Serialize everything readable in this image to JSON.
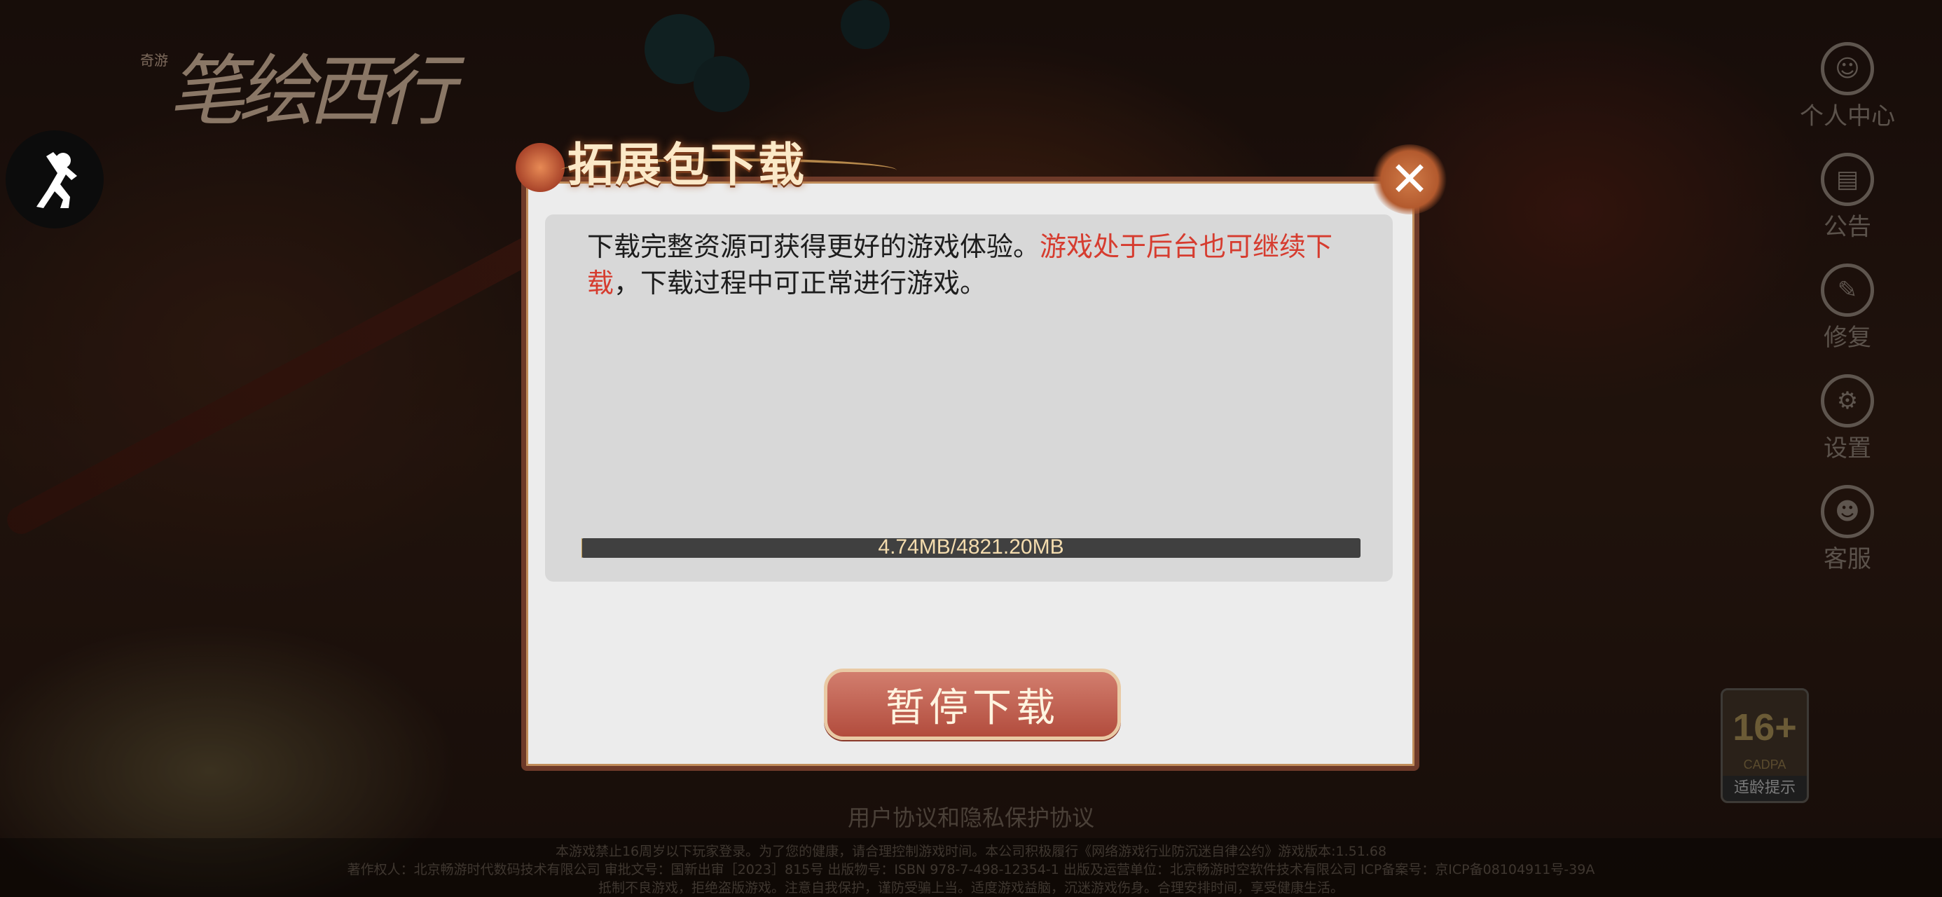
{
  "background": {
    "logo_small": "奇游",
    "logo_big": "笔绘西行"
  },
  "side_menu": [
    {
      "icon": "person-icon",
      "label": "个人中心"
    },
    {
      "icon": "notice-icon",
      "label": "公告"
    },
    {
      "icon": "repair-icon",
      "label": "修复"
    },
    {
      "icon": "gear-icon",
      "label": "设置"
    },
    {
      "icon": "support-icon",
      "label": "客服"
    }
  ],
  "age_rating": {
    "number": "16+",
    "sub": "CADPA",
    "tip": "适龄提示"
  },
  "agreement_link": "用户协议和隐私保护协议",
  "legal_lines": [
    "本游戏禁止16周岁以下玩家登录。为了您的健康，请合理控制游戏时间。本公司积极履行《网络游戏行业防沉迷自律公约》游戏版本:1.51.68",
    "著作权人：北京畅游时代数码技术有限公司 审批文号：国新出审［2023］815号 出版物号：ISBN 978-7-498-12354-1 出版及运营单位：北京畅游时空软件技术有限公司 ICP备案号：京ICP备08104911号-39A",
    "抵制不良游戏，拒绝盗版游戏。注意自我保护，谨防受骗上当。适度游戏益脑，沉迷游戏伤身。合理安排时间，享受健康生活。"
  ],
  "dialog": {
    "title": "拓展包下载",
    "message_part1": "下载完整资源可获得更好的游戏体验。",
    "message_highlight": "游戏处于后台也可继续下载",
    "message_part2": "，下载过程中可正常进行游戏。",
    "progress_text": "4.74MB/4821.20MB",
    "progress_fraction": 0.001,
    "pause_label": "暂停下载",
    "close_symbol": "✕"
  },
  "colors": {
    "highlight": "#d63c2f",
    "frame": "#6e3a29",
    "button": "#b24c3d"
  }
}
